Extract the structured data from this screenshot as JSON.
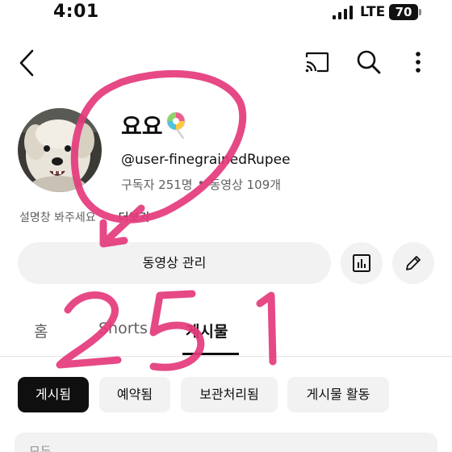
{
  "status_bar": {
    "time": "4:01",
    "network": "LTE",
    "battery": "70"
  },
  "channel": {
    "name": "요요",
    "handle": "@user-finegrainedRupee",
    "subscribers": "구독자 251명",
    "separator": "•",
    "videos": "동영상 109개",
    "description": "설명창 봐주세요",
    "more": "더보기"
  },
  "actions": {
    "manage_label": "동영상 관리"
  },
  "tabs": [
    {
      "label": "홈"
    },
    {
      "label": "Shorts"
    },
    {
      "label": "게시물"
    }
  ],
  "chips": [
    {
      "label": "게시됨"
    },
    {
      "label": "예약됨"
    },
    {
      "label": "보관처리됨"
    },
    {
      "label": "게시물 활동"
    }
  ],
  "bottom_card": {
    "text": "모두"
  },
  "annotation": {
    "handwritten": "251"
  },
  "colors": {
    "annotation": "#e43a7c",
    "text": "#0f0f0f",
    "muted": "#606060",
    "chip_bg": "#f2f2f2"
  }
}
